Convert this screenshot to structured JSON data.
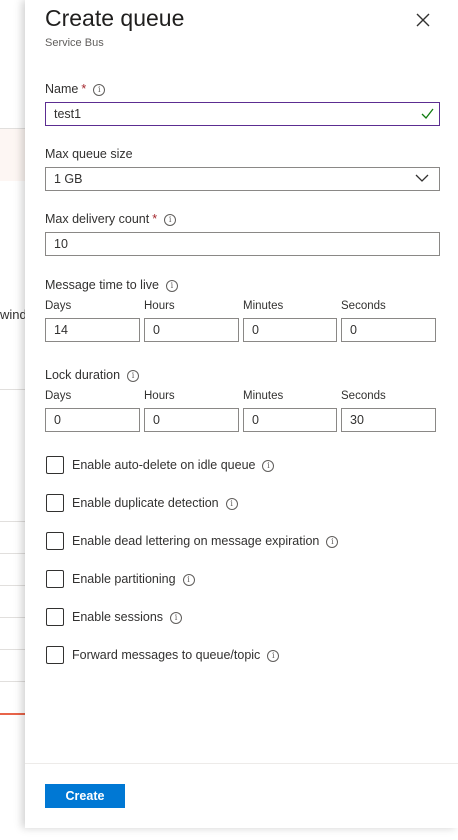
{
  "background": {
    "cut_text": "winde"
  },
  "blade": {
    "title": "Create queue",
    "subtitle": "Service Bus"
  },
  "fields": {
    "name": {
      "label": "Name",
      "required": "*",
      "value": "test1"
    },
    "max_queue_size": {
      "label": "Max queue size",
      "value": "1 GB"
    },
    "max_delivery_count": {
      "label": "Max delivery count",
      "required": "*",
      "value": "10"
    },
    "message_ttl": {
      "label": "Message time to live",
      "days_label": "Days",
      "days": "14",
      "hours_label": "Hours",
      "hours": "0",
      "minutes_label": "Minutes",
      "minutes": "0",
      "seconds_label": "Seconds",
      "seconds": "0"
    },
    "lock_duration": {
      "label": "Lock duration",
      "days_label": "Days",
      "days": "0",
      "hours_label": "Hours",
      "hours": "0",
      "minutes_label": "Minutes",
      "minutes": "0",
      "seconds_label": "Seconds",
      "seconds": "30"
    }
  },
  "checkboxes": [
    {
      "label": "Enable auto-delete on idle queue",
      "checked": false
    },
    {
      "label": "Enable duplicate detection",
      "checked": false
    },
    {
      "label": "Enable dead lettering on message expiration",
      "checked": false
    },
    {
      "label": "Enable partitioning",
      "checked": false
    },
    {
      "label": "Enable sessions",
      "checked": false
    },
    {
      "label": "Forward messages to queue/topic",
      "checked": false
    }
  ],
  "footer": {
    "create_label": "Create"
  },
  "icons": {
    "info": "i",
    "close": "close-icon",
    "valid": "checkmark-icon",
    "dropdown": "chevron-down-icon"
  },
  "colors": {
    "accent": "#0078d4",
    "required": "#a4262c",
    "valid": "#107c10",
    "valid_border": "#5c2d91"
  }
}
